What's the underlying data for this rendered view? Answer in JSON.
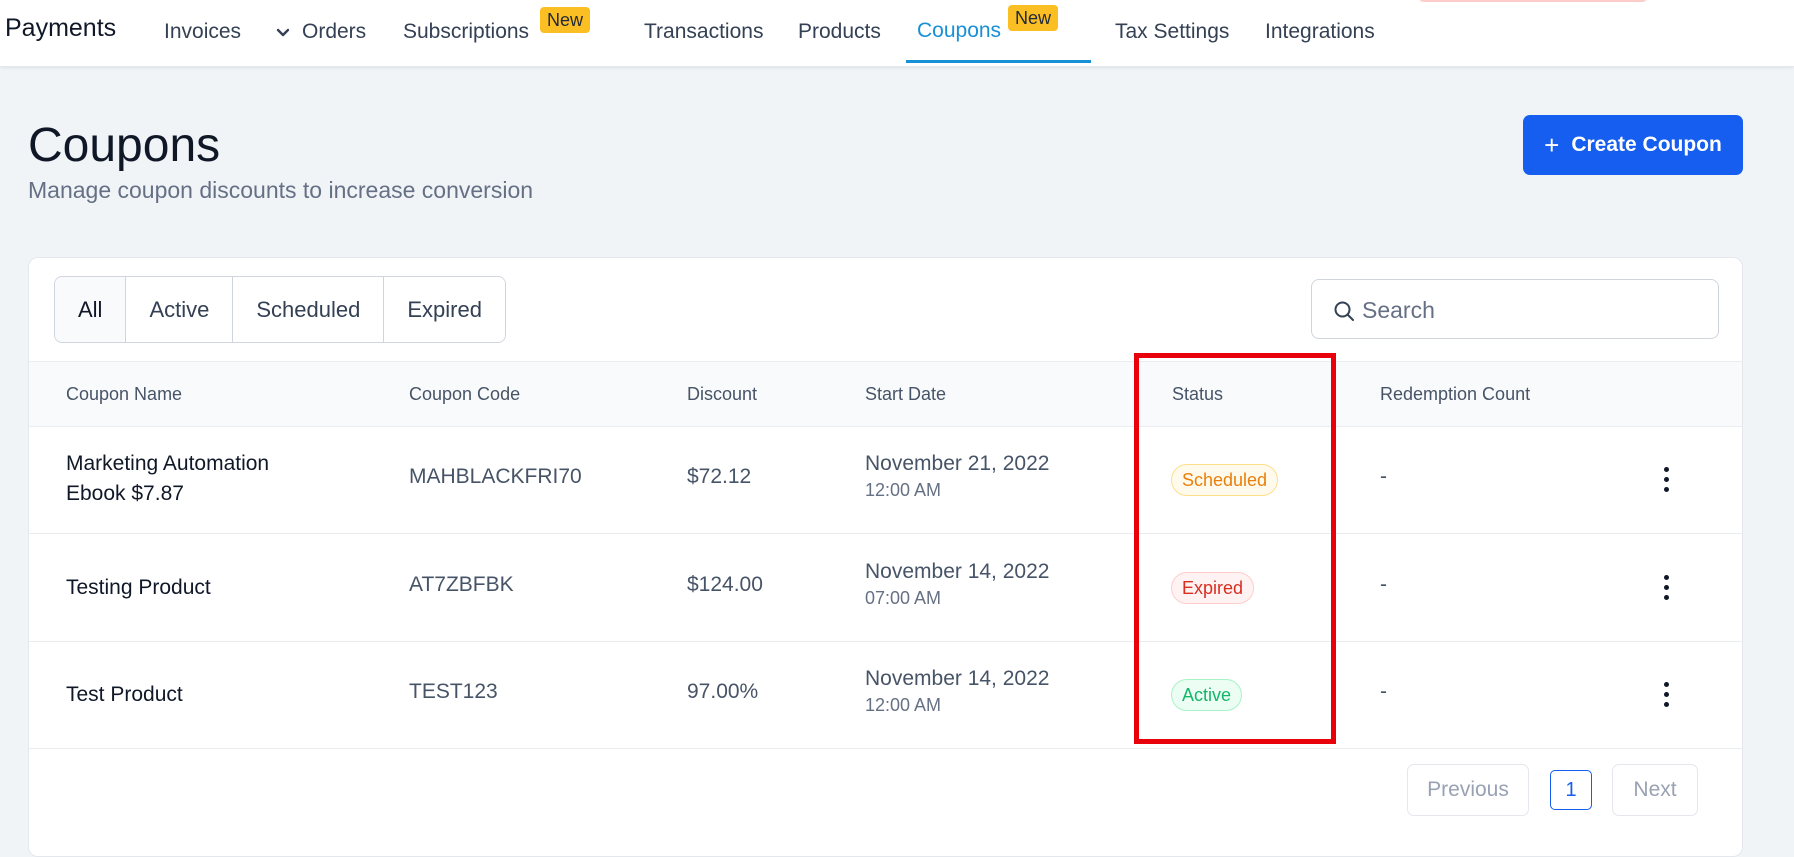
{
  "nav": {
    "brand": "Payments",
    "items": [
      {
        "label": "Invoices"
      },
      {
        "label": "Orders"
      },
      {
        "label": "Subscriptions",
        "badge": "New"
      },
      {
        "label": "Transactions"
      },
      {
        "label": "Products"
      },
      {
        "label": "Coupons",
        "badge": "New",
        "active": true
      },
      {
        "label": "Tax Settings"
      },
      {
        "label": "Integrations"
      }
    ]
  },
  "header": {
    "title": "Coupons",
    "subtitle": "Manage coupon discounts to increase conversion",
    "create_button": "Create Coupon"
  },
  "filters": {
    "tabs": [
      "All",
      "Active",
      "Scheduled",
      "Expired"
    ],
    "selected": "All"
  },
  "search": {
    "placeholder": "Search"
  },
  "table": {
    "columns": [
      "Coupon Name",
      "Coupon Code",
      "Discount",
      "Start Date",
      "Status",
      "Redemption Count"
    ],
    "rows": [
      {
        "name": "Marketing Automation Ebook $7.87",
        "code": "MAHBLACKFRI70",
        "discount": "$72.12",
        "date": "November 21, 2022",
        "time": "12:00 AM",
        "status": "Scheduled",
        "redemptions": "-"
      },
      {
        "name": "Testing Product",
        "code": "AT7ZBFBK",
        "discount": "$124.00",
        "date": "November 14, 2022",
        "time": "07:00 AM",
        "status": "Expired",
        "redemptions": "-"
      },
      {
        "name": "Test Product",
        "code": "TEST123",
        "discount": "97.00%",
        "date": "November 14, 2022",
        "time": "12:00 AM",
        "status": "Active",
        "redemptions": "-"
      }
    ]
  },
  "pagination": {
    "previous": "Previous",
    "page": "1",
    "next": "Next"
  },
  "colors": {
    "primary": "#155eef",
    "active_nav": "#1890d6",
    "badge_new": "#fbbf24",
    "status_scheduled": "#e8800c",
    "status_expired": "#d92d20",
    "status_active": "#12b76a",
    "highlight": "#e8000b"
  }
}
